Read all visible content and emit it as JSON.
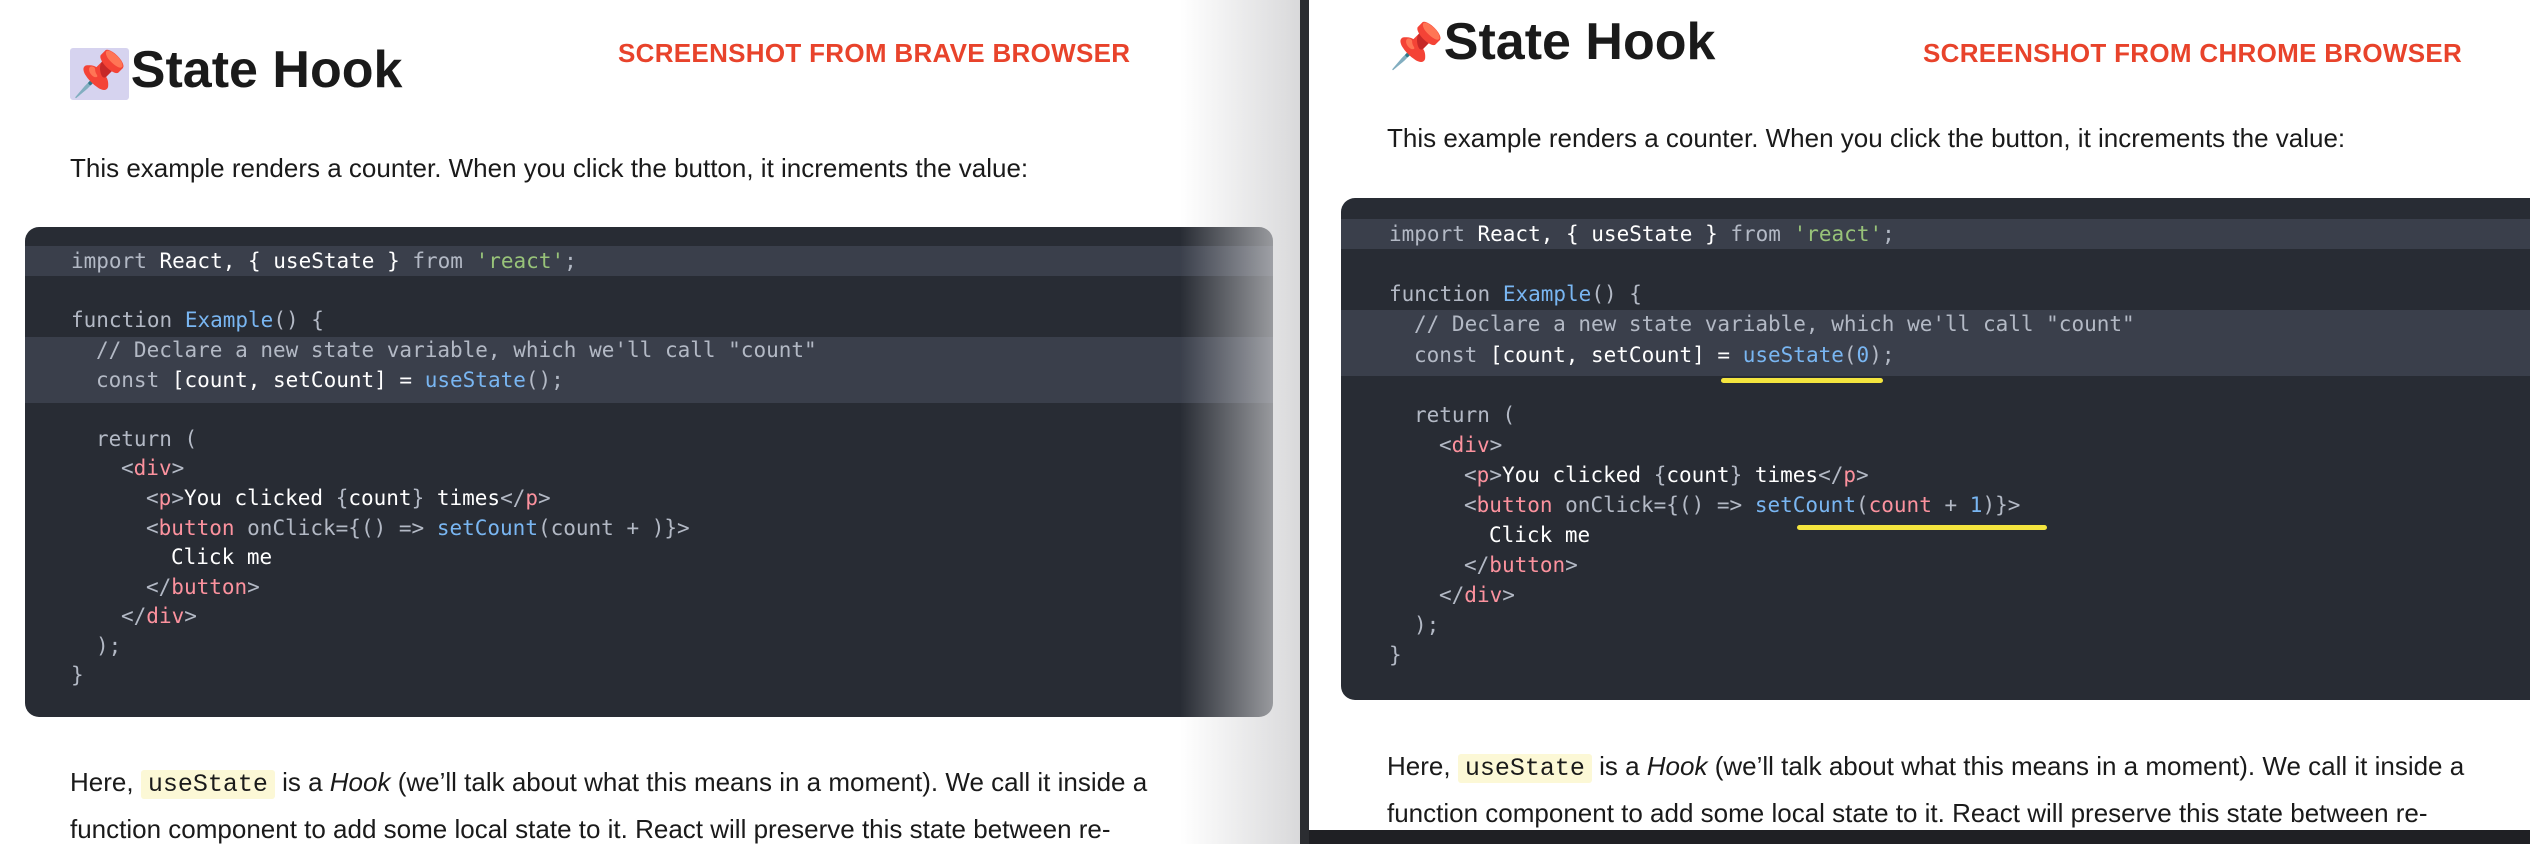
{
  "left": {
    "title": "State Hook",
    "caption": "SCREENSHOT FROM BRAVE BROWSER",
    "intro": "This example renders a counter. When you click the button, it increments the value:",
    "body": {
      "pre": "Here, ",
      "code": "useState",
      "mid1": " is a ",
      "hook": "Hook",
      "rest1": " (we’ll talk about what this means in a moment). We call it inside a function component to add some local state to it. React will preserve this state between re-"
    },
    "code": {
      "l1": {
        "kw1": "import",
        "t1": " React, { useState } ",
        "kw2": "from",
        "sp": " ",
        "str": "'react'",
        "end": ";"
      },
      "l2": {
        "kw": "function",
        "sp": " ",
        "fn": "Example",
        "rest": "() {"
      },
      "l3": {
        "cm": "// Declare a new state variable, which we'll call \"count\""
      },
      "l4": {
        "kw": "const",
        "mid": " [count, setCount] = ",
        "fn": "useState",
        "rest": "();"
      },
      "l5": {
        "kw": "return",
        "rest": " ("
      },
      "l6": {
        "open": "<",
        "tag": "div",
        "close": ">"
      },
      "l7": {
        "open": "<",
        "tag": "p",
        "close": ">",
        "text": "You clicked ",
        "ob": "{",
        "var": "count",
        "cb": "}",
        "text2": " times",
        "eopen": "</",
        "etag": "p",
        "eclose": ">"
      },
      "l8": {
        "open": "<",
        "tag": "button",
        "attr": " onClick={() => ",
        "fn": "setCount",
        "args": "(count + )",
        "close": "}>"
      },
      "l9": {
        "text": "Click me"
      },
      "l10": {
        "open": "</",
        "tag": "button",
        "close": ">"
      },
      "l11": {
        "open": "</",
        "tag": "div",
        "close": ">"
      },
      "l12": {
        "text": ");"
      },
      "l13": {
        "text": "}"
      }
    }
  },
  "right": {
    "title": "State Hook",
    "caption": "SCREENSHOT FROM CHROME BROWSER",
    "intro": "This example renders a counter. When you click the button, it increments the value:",
    "body": {
      "pre": "Here, ",
      "code": "useState",
      "mid1": " is a ",
      "hook": "Hook",
      "rest1": " (we’ll talk about what this means in a moment). We call it inside a function component to add some local state to it. React will preserve this state between re-"
    },
    "code": {
      "l1": {
        "kw1": "import",
        "t1": " React, { useState } ",
        "kw2": "from",
        "sp": " ",
        "str": "'react'",
        "end": ";"
      },
      "l2": {
        "kw": "function",
        "sp": " ",
        "fn": "Example",
        "rest": "() {"
      },
      "l3": {
        "cm": "// Declare a new state variable, which we'll call \"count\""
      },
      "l4": {
        "kw": "const",
        "mid": " [count, setCount] = ",
        "fn": "useState",
        "paren1": "(",
        "num": "0",
        "paren2": ");"
      },
      "l5": {
        "kw": "return",
        "rest": " ("
      },
      "l6": {
        "open": "<",
        "tag": "div",
        "close": ">"
      },
      "l7": {
        "open": "<",
        "tag": "p",
        "close": ">",
        "text": "You clicked ",
        "ob": "{",
        "var": "count",
        "cb": "}",
        "text2": " times",
        "eopen": "</",
        "etag": "p",
        "eclose": ">"
      },
      "l8": {
        "open": "<",
        "tag": "button",
        "attr": " onClick={() => ",
        "fn": "setCount",
        "p1": "(",
        "var": "count",
        "plus": " + ",
        "num": "1",
        "p2": ")}",
        "close": ">"
      },
      "l9": {
        "text": "Click me"
      },
      "l10": {
        "open": "</",
        "tag": "button",
        "close": ">"
      },
      "l11": {
        "open": "</",
        "tag": "div",
        "close": ">"
      },
      "l12": {
        "text": ");"
      },
      "l13": {
        "text": "}"
      }
    },
    "highlight_color": "#f4e53e"
  },
  "pin_emoji": "📌"
}
